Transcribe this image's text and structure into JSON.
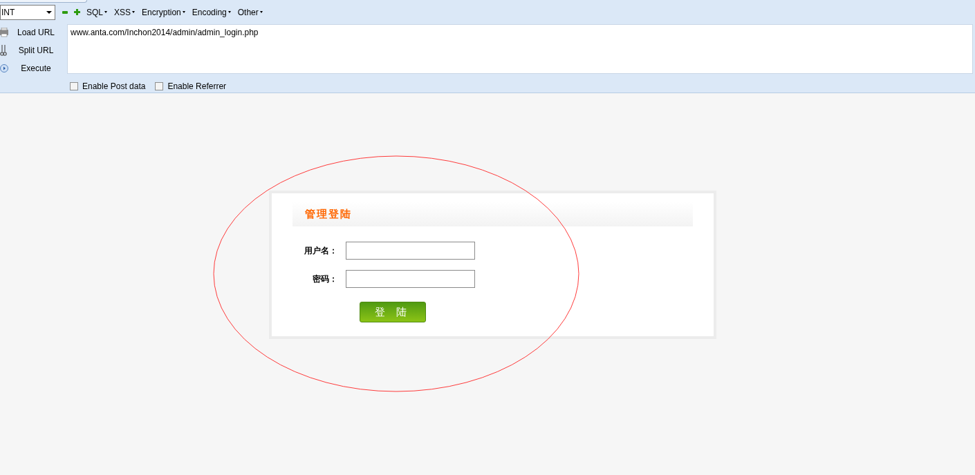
{
  "toolbar": {
    "select": "INT",
    "menus": [
      {
        "label": "SQL"
      },
      {
        "label": "XSS"
      },
      {
        "label": "Encryption"
      },
      {
        "label": "Encoding"
      },
      {
        "label": "Other"
      }
    ]
  },
  "actions": [
    {
      "label": "Load URL",
      "kind": "load"
    },
    {
      "label": "Split URL",
      "kind": "split"
    },
    {
      "label": "Execute",
      "kind": "execute"
    }
  ],
  "url": "www.anta.com/Inchon2014/admin/admin_login.php",
  "options": [
    {
      "label": "Enable Post data",
      "checked": false
    },
    {
      "label": "Enable Referrer",
      "checked": false
    }
  ],
  "login": {
    "title": "管理登陆",
    "fields": [
      {
        "label": "用户名："
      },
      {
        "label": "密码："
      }
    ],
    "button": "登 陆"
  }
}
